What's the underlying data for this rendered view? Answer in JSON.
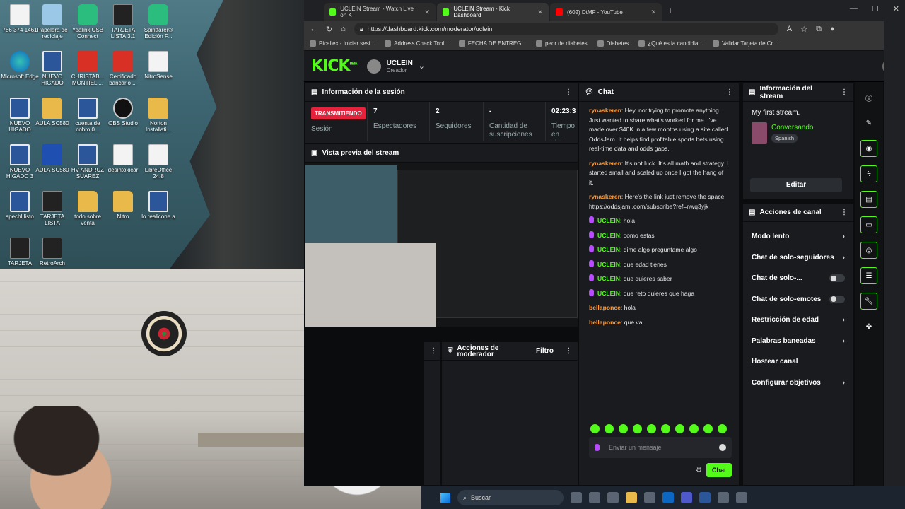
{
  "desktop": {
    "icons": [
      {
        "label": "786 374 1461",
        "kind": "doc"
      },
      {
        "label": "Papelera de reciclaje",
        "kind": "bin"
      },
      {
        "label": "Yealink USB Connect",
        "kind": "green"
      },
      {
        "label": "TARJETA LISTA 3.1",
        "kind": "dark"
      },
      {
        "label": "Spiritfarer® Edición F...",
        "kind": "green"
      },
      {
        "label": "Microsoft Edge",
        "kind": "edge"
      },
      {
        "label": "NUEVO HIGADO",
        "kind": "word"
      },
      {
        "label": "CHRISTAB... MONTIEL ...",
        "kind": "pdf"
      },
      {
        "label": "Certificado bancario ...",
        "kind": "pdf"
      },
      {
        "label": "NitroSense",
        "kind": "doc"
      },
      {
        "label": "NUEVO HIGADO",
        "kind": "word"
      },
      {
        "label": "AULA SC580",
        "kind": "fold"
      },
      {
        "label": "cuenta de cobro 0...",
        "kind": "word"
      },
      {
        "label": "OBS Studio",
        "kind": "obs"
      },
      {
        "label": "Norton Installati...",
        "kind": "fold"
      },
      {
        "label": "NUEVO HIGADO 3",
        "kind": "word"
      },
      {
        "label": "AULA SC580",
        "kind": "blue"
      },
      {
        "label": "HV ANDRUZ SUAREZ",
        "kind": "word"
      },
      {
        "label": "desintoxicar",
        "kind": "doc"
      },
      {
        "label": "LibreOffice 24.8",
        "kind": "doc"
      },
      {
        "label": "spechl listo",
        "kind": "word"
      },
      {
        "label": "TARJETA LISTA",
        "kind": "dark"
      },
      {
        "label": "todo sobre venta",
        "kind": "fold"
      },
      {
        "label": "Nitro",
        "kind": "fold"
      },
      {
        "label": "lo realicone a",
        "kind": "word"
      },
      {
        "label": "TARJETA",
        "kind": "dark"
      },
      {
        "label": "RetroArch",
        "kind": "dark"
      }
    ]
  },
  "browser": {
    "tabs": [
      {
        "label": "UCLEIN Stream - Watch Live on K",
        "icon": "kick"
      },
      {
        "label": "UCLEIN Stream - Kick Dashboard",
        "icon": "kick"
      },
      {
        "label": "(602) DtMF - YouTube",
        "icon": "yt"
      }
    ],
    "url": "https://dashboard.kick.com/moderator/uclein",
    "bookmarks": [
      "Picallex - Iniciar sesi...",
      "Address Check Tool...",
      "FECHA DE ENTREG...",
      "peor de diabetes",
      "Diabetes",
      "¿Qué es la candidia...",
      "Validar Tarjeta de Cr..."
    ]
  },
  "kick": {
    "logo": "KICK",
    "beta": "BETA",
    "channel": "UCLEIN",
    "role": "Creador"
  },
  "session": {
    "title": "Información de la sesión",
    "status": "TRANSMITIENDO",
    "status_label": "Sesión",
    "stats": [
      {
        "value": "7",
        "label": "Espectadores"
      },
      {
        "value": "2",
        "label": "Seguidores"
      },
      {
        "value": "-",
        "label": "Cantidad de suscripciones"
      },
      {
        "value": "02:23:3",
        "label": "Tiempo en vivo"
      }
    ]
  },
  "preview": {
    "title": "Vista previa del stream"
  },
  "mod": {
    "title": "Acciones de moderador",
    "filter": "Filtro"
  },
  "chat": {
    "title": "Chat",
    "messages": [
      {
        "user": "rynaskeren",
        "text": "Hey, not trying to promote anything. Just wanted to share what's worked for me. I've made over $40K in a few months using a site called OddsJam. It helps find profitable sports bets using real-time data and odds gaps.",
        "color": "g",
        "mic": false
      },
      {
        "user": "rynaskeren",
        "text": "It's not luck. It's all math and strategy. I started small and scaled up once I got the hang of it.",
        "color": "g",
        "mic": false
      },
      {
        "user": "rynaskeren",
        "text": "Here's the link just remove the space https://oddsjam .com/subscribe?ref=nwq3yjk",
        "color": "g",
        "mic": false
      },
      {
        "user": "UCLEIN",
        "text": "hola",
        "color": "m",
        "mic": true
      },
      {
        "user": "UCLEIN",
        "text": "como estas",
        "color": "m",
        "mic": true
      },
      {
        "user": "UCLEIN",
        "text": "dime algo preguntame algo",
        "color": "m",
        "mic": true
      },
      {
        "user": "UCLEIN",
        "text": "que edad tienes",
        "color": "m",
        "mic": true
      },
      {
        "user": "UCLEIN",
        "text": "que quieres saber",
        "color": "m",
        "mic": true
      },
      {
        "user": "UCLEIN",
        "text": "que reto quieres que haga",
        "color": "m",
        "mic": true
      },
      {
        "user": "bellaponce",
        "text": "hola",
        "color": "b",
        "mic": false
      },
      {
        "user": "bellaponce",
        "text": "que va",
        "color": "b",
        "mic": false
      }
    ],
    "placeholder": "Enviar un mensaje",
    "send": "Chat"
  },
  "info": {
    "title": "Información del stream",
    "stream_title": "My first stream.",
    "category": "Conversando",
    "language": "Spanish",
    "edit": "Editar"
  },
  "actions": {
    "title": "Acciones de canal",
    "items": [
      {
        "label": "Modo lento",
        "type": "arrow"
      },
      {
        "label": "Chat de solo-seguidores",
        "type": "arrow"
      },
      {
        "label": "Chat de solo-...",
        "type": "toggle"
      },
      {
        "label": "Chat de solo-emotes",
        "type": "toggle"
      },
      {
        "label": "Restricción de edad",
        "type": "arrow"
      },
      {
        "label": "Palabras baneadas",
        "type": "arrow"
      },
      {
        "label": "Hostear canal",
        "type": "none"
      },
      {
        "label": "Configurar objetivos",
        "type": "arrow"
      }
    ]
  },
  "taskbar": {
    "search": "Buscar"
  },
  "colors": {
    "accent": "#53fc18",
    "live": "#e5213c",
    "bg": "#191b1f"
  }
}
